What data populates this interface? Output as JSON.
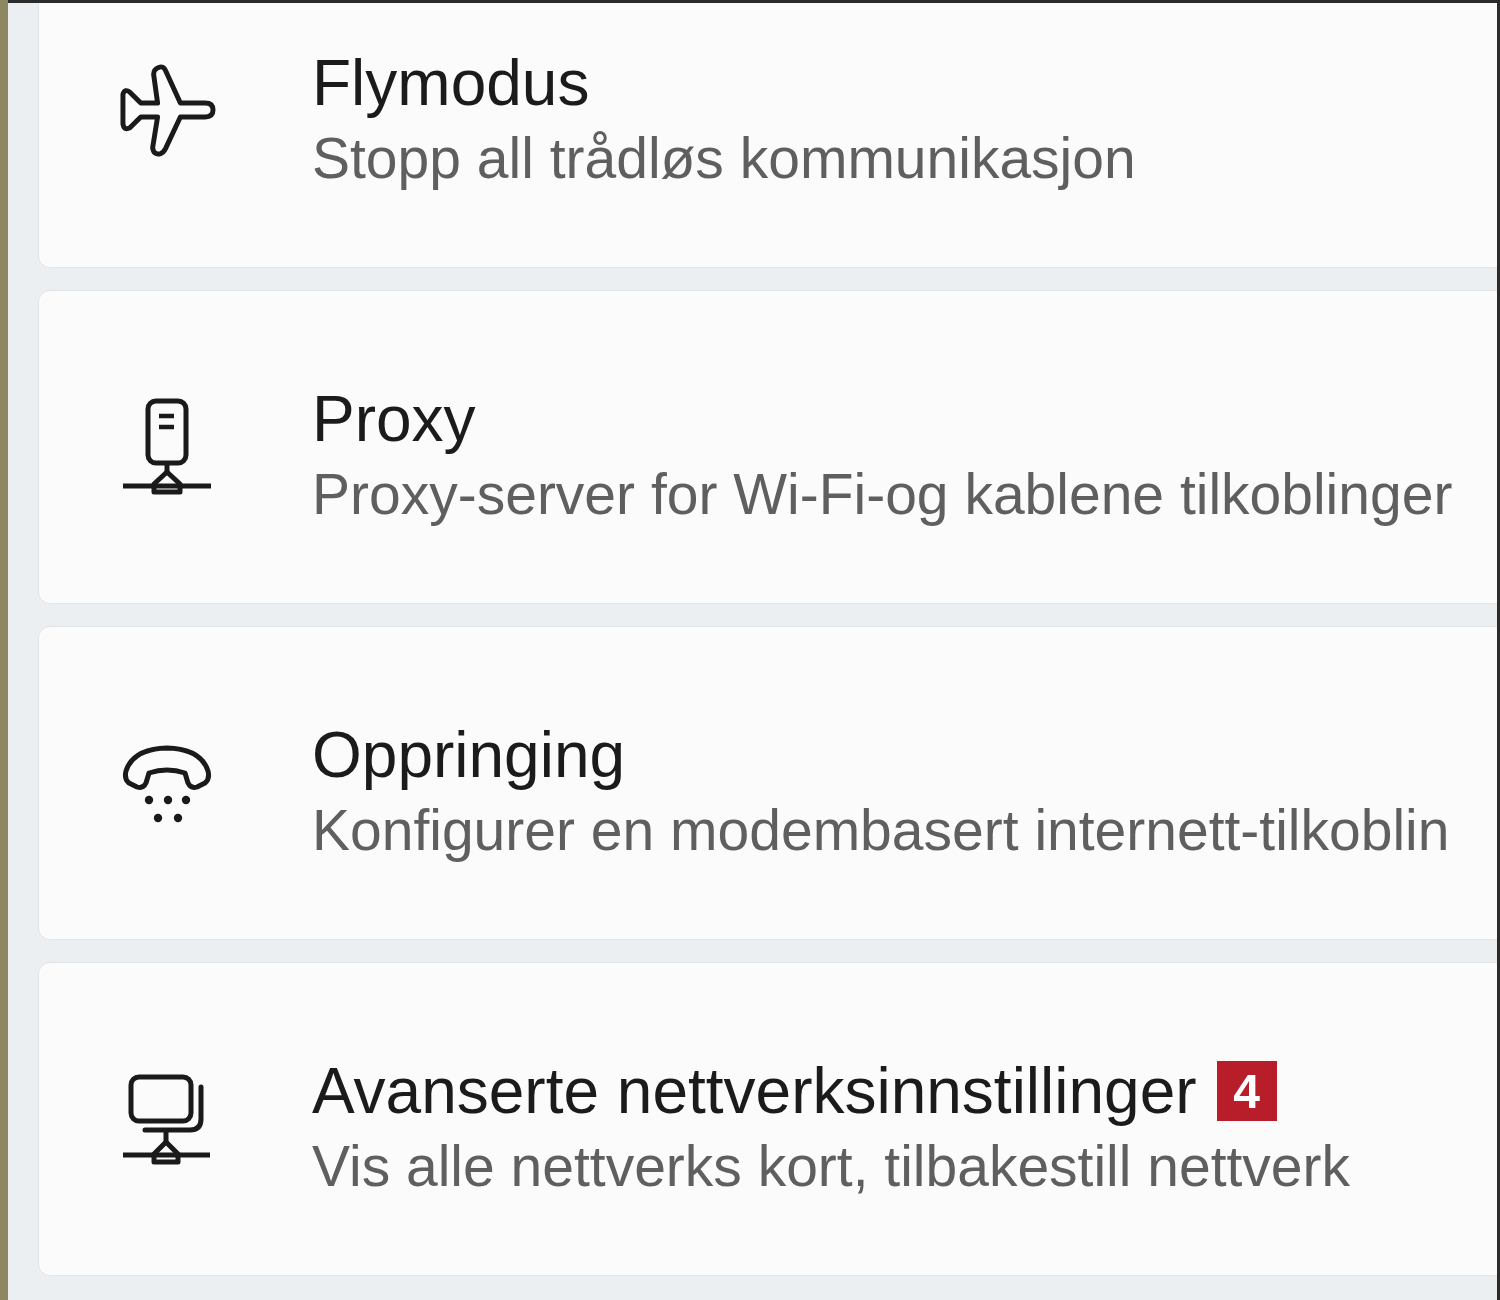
{
  "items": [
    {
      "title": "Flymodus",
      "description": "Stopp all trådløs kommunikasjon"
    },
    {
      "title": "Proxy",
      "description": "Proxy-server for Wi-Fi-og kablene tilkoblinger"
    },
    {
      "title": "Oppringing",
      "description": "Konfigurer en modembasert internett-tilkoblin"
    },
    {
      "title": "Avanserte nettverksinnstillinger",
      "badge": "4",
      "description": "Vis alle nettverks kort, tilbakestill nettverk"
    }
  ]
}
